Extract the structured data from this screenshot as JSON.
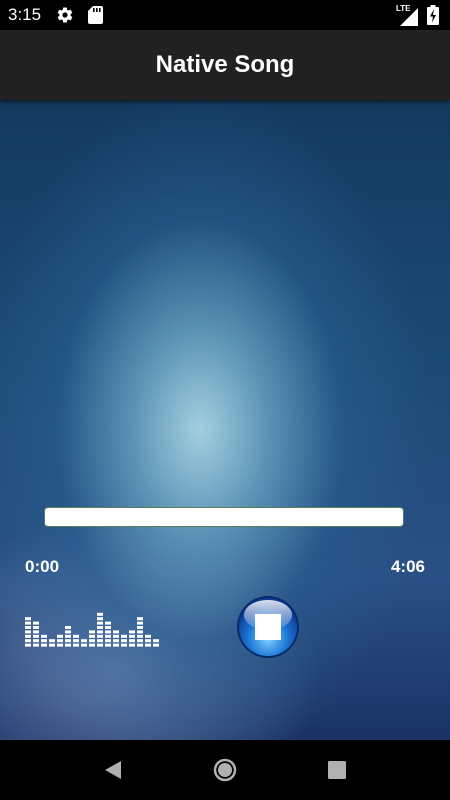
{
  "status_bar": {
    "time": "3:15",
    "network": "LTE",
    "icons": [
      "gear-icon",
      "sd-card-icon",
      "signal-icon",
      "battery-charging-icon"
    ]
  },
  "app_bar": {
    "title": "Native Song"
  },
  "player": {
    "current_time": "0:00",
    "total_time": "4:06",
    "progress_fraction": 0.0,
    "control_icon": "stop-icon",
    "equalizer_icon": "equalizer-icon"
  },
  "nav_bar": {
    "icons": [
      "back-icon",
      "home-icon",
      "recents-icon"
    ]
  },
  "colors": {
    "status_bar_bg": "#000000",
    "app_bar_bg": "#212121",
    "background_dark": "#14395f",
    "background_light": "#aad7e6",
    "progress_track": "#ffffff",
    "progress_fill": "#3a9a3a",
    "button_blue": "#1e64c8"
  }
}
